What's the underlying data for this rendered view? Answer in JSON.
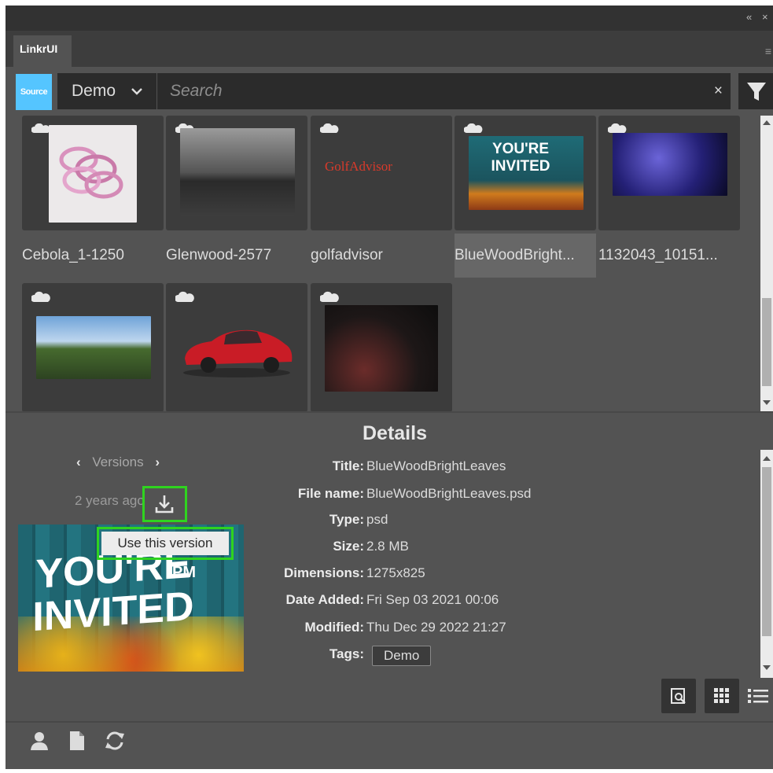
{
  "window": {
    "controls": [
      "«",
      "×"
    ],
    "menu_icon": "≡"
  },
  "tab": {
    "label": "LinkrUI"
  },
  "toolbar": {
    "source_label": "Source",
    "library_value": "Demo",
    "search_placeholder": "Search",
    "clear_icon": "×",
    "filter_icon": "filter-icon"
  },
  "assets": [
    {
      "name": "Cebola_1-1250",
      "cloud": true
    },
    {
      "name": "Glenwood-2577",
      "cloud": true
    },
    {
      "name": "golfadvisor",
      "cloud": true,
      "logo_text": "GolfAdvisor"
    },
    {
      "name": "BlueWoodBright...",
      "cloud": true,
      "selected": true,
      "thumb_text": "YOU'RE INVITED"
    },
    {
      "name": "1132043_10151...",
      "cloud": true
    },
    {
      "name": "",
      "cloud": true
    },
    {
      "name": "",
      "cloud": true
    },
    {
      "name": "",
      "cloud": true
    }
  ],
  "details": {
    "heading": "Details",
    "versions_label": "Versions",
    "age": "2 years ago",
    "tooltip": "Use this version",
    "preview_text": "YOU'RE INVITED",
    "preview_subtext": "PM",
    "fields": [
      {
        "label": "Title:",
        "value": "BlueWoodBrightLeaves"
      },
      {
        "label": "File name:",
        "value": "BlueWoodBrightLeaves.psd"
      },
      {
        "label": "Type:",
        "value": "psd"
      },
      {
        "label": "Size:",
        "value": "2.8 MB"
      },
      {
        "label": "Dimensions:",
        "value": "1275x825"
      },
      {
        "label": "Date Added:",
        "value": "Fri Sep 03 2021 00:06"
      },
      {
        "label": "Modified:",
        "value": "Thu Dec 29 2022 21:27"
      },
      {
        "label": "Tags:",
        "value": ""
      }
    ],
    "tags": [
      "Demo"
    ]
  },
  "view_buttons": [
    "preview-icon",
    "grid-view-icon",
    "list-view-icon"
  ],
  "footer_icons": [
    "user-icon",
    "document-icon",
    "refresh-icon"
  ],
  "colors": {
    "accent": "#55c5ff",
    "highlight": "#2fd31f",
    "panel": "#535353"
  }
}
